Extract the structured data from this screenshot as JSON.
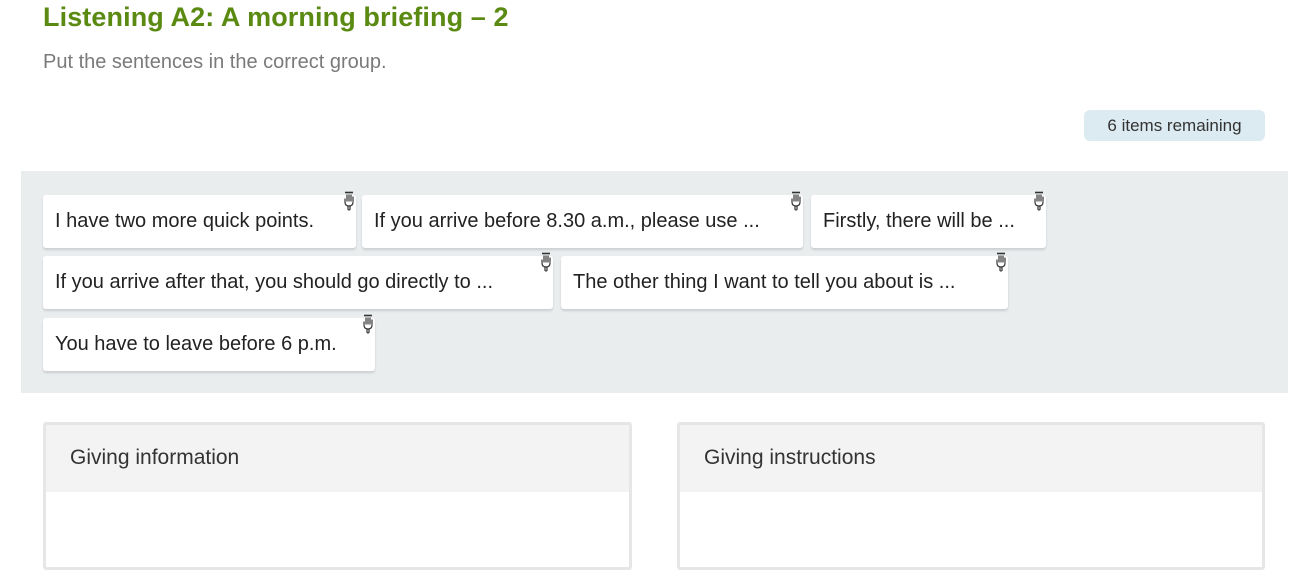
{
  "header": {
    "title": "Listening A2: A morning briefing – 2",
    "instructions": "Put the sentences in the correct group."
  },
  "status": {
    "remaining": "6 items remaining"
  },
  "pool": {
    "items": [
      {
        "label": "I have two more quick points."
      },
      {
        "label": "If you arrive before 8.30 a.m., please use ..."
      },
      {
        "label": "Firstly, there will be ..."
      },
      {
        "label": "If you arrive after that, you should go directly to ..."
      },
      {
        "label": "The other thing I want to tell you about is ..."
      },
      {
        "label": "You have to leave before 6 p.m."
      }
    ],
    "drag_icon": "hand-drag-icon"
  },
  "groups": [
    {
      "title": "Giving information"
    },
    {
      "title": "Giving instructions"
    }
  ],
  "colors": {
    "title": "#5a8a12",
    "badge_bg": "#dcebf1",
    "pool_bg": "#e9edee"
  }
}
